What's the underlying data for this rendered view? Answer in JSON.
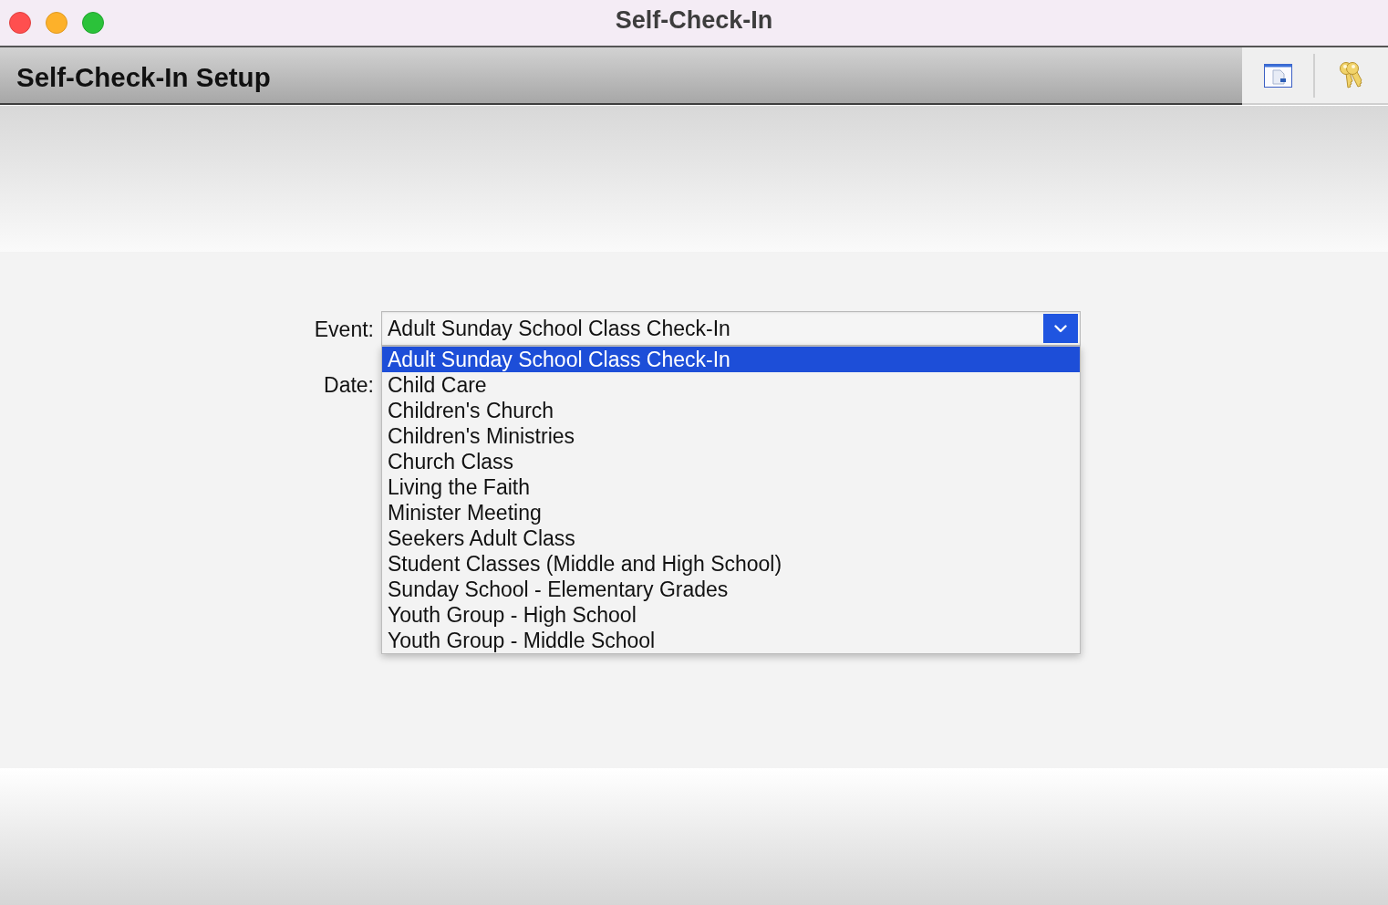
{
  "window": {
    "title": "Self-Check-In",
    "controls": [
      {
        "kind": "close"
      },
      {
        "kind": "minimize"
      },
      {
        "kind": "zoom"
      }
    ]
  },
  "header": {
    "title": "Self-Check-In Setup",
    "tools": [
      {
        "kind": "window"
      },
      {
        "kind": "keys"
      }
    ]
  },
  "event": {
    "label": "Event:",
    "value": "Adult Sunday School Class Check-In",
    "expanded": true,
    "options": [
      {
        "label": "Adult Sunday School Class Check-In",
        "selected": true
      },
      {
        "label": "Child Care",
        "selected": false
      },
      {
        "label": "Children's Church",
        "selected": false
      },
      {
        "label": "Children's Ministries",
        "selected": false
      },
      {
        "label": "Church Class",
        "selected": false
      },
      {
        "label": "Living the Faith",
        "selected": false
      },
      {
        "label": "Minister Meeting",
        "selected": false
      },
      {
        "label": "Seekers Adult Class",
        "selected": false
      },
      {
        "label": "Student Classes (Middle and High School)",
        "selected": false
      },
      {
        "label": "Sunday School - Elementary Grades",
        "selected": false
      },
      {
        "label": "Youth Group - High School",
        "selected": false
      },
      {
        "label": "Youth Group - Middle School",
        "selected": false
      }
    ]
  },
  "date": {
    "label": "Date:"
  }
}
